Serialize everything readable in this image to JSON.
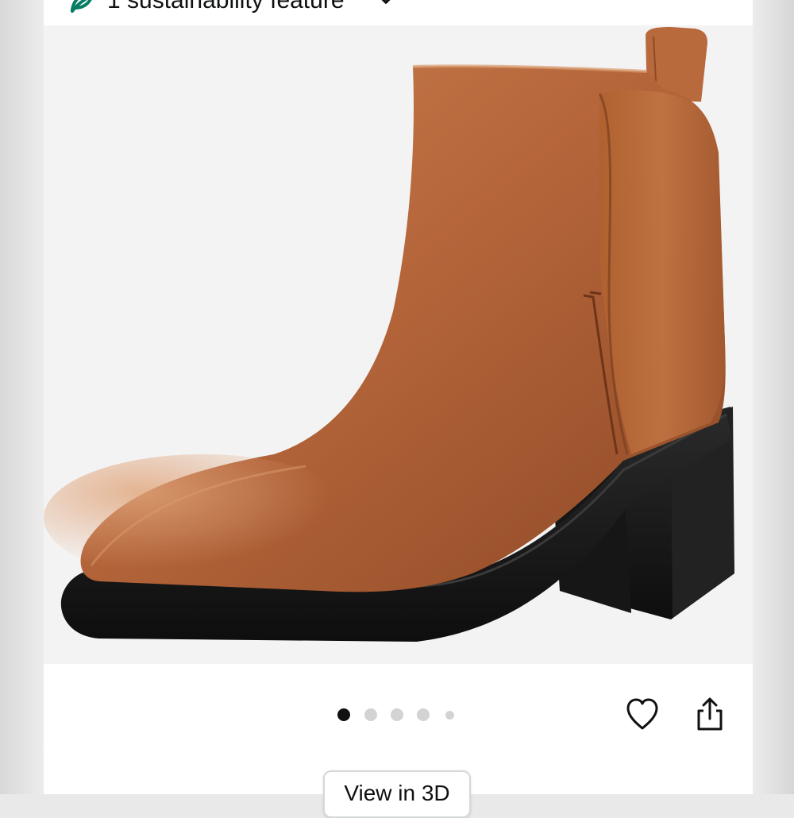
{
  "sustainability": {
    "label": "1 sustainability feature",
    "icon": "leaf-icon",
    "accent": "#067d62"
  },
  "product_image": {
    "alt": "Brown leather ankle boot with black block heel",
    "upper_color": "#b86a3d",
    "sole_color": "#1a1a1a"
  },
  "carousel": {
    "count": 5,
    "active_index": 0
  },
  "actions": {
    "wishlist_icon": "heart-icon",
    "share_icon": "share-icon"
  },
  "view_3d": {
    "label": "View in 3D"
  }
}
